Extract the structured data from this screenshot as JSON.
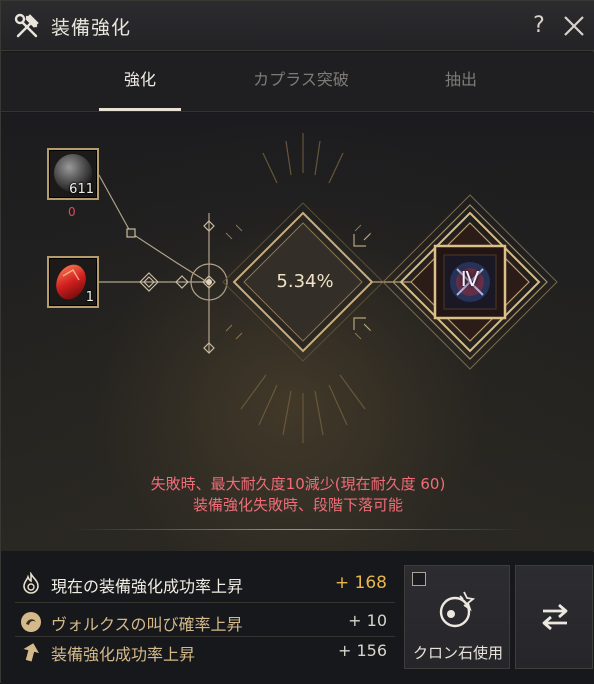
{
  "window": {
    "title": "装備強化"
  },
  "titlebar": {
    "help_label": "?",
    "icons": {
      "title": "hammer-wrench-icon",
      "close": "close-icon"
    }
  },
  "tabs": [
    {
      "label": "強化",
      "active": true
    },
    {
      "label": "カプラス突破",
      "active": false
    },
    {
      "label": "抽出",
      "active": false
    }
  ],
  "materials": [
    {
      "name": "black-stone",
      "count": "611",
      "sub": "0"
    },
    {
      "name": "red-gem",
      "count": "1"
    }
  ],
  "enhance": {
    "success_rate": "5.34%",
    "target_grade": "Ⅳ"
  },
  "warning": {
    "line1": "失敗時、最大耐久度10減少(現在耐久度 60)",
    "line2": "装備強化失敗時、段階下落可能"
  },
  "stats": [
    {
      "label": "現在の装備強化成功率上昇",
      "value": "+ 168",
      "icon": "flame-swirl-icon"
    },
    {
      "label": "ヴォルクスの叫び確率上昇",
      "value": "+ 10",
      "icon": "vorks-cry-icon"
    },
    {
      "label": "装備強化成功率上昇",
      "value": "+ 156",
      "icon": "arrow-up-icon"
    }
  ],
  "cron": {
    "label": "クロン石使用",
    "checked": false
  },
  "colors": {
    "gold": "#e8b64a",
    "warning": "#f06d78",
    "accent_border": "#b69b6b",
    "label_primary": "#f1ede4",
    "label_secondary": "#d4b98a"
  }
}
